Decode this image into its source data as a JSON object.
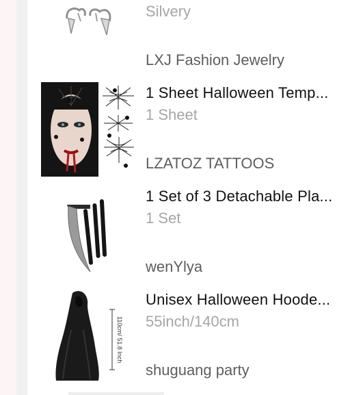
{
  "items": [
    {
      "title": "",
      "variant": "Silvery",
      "store": "LXJ Fashion Jewelry",
      "image": "vampire-fangs-image"
    },
    {
      "title": "1 Sheet Halloween Temp...",
      "variant": "1 Sheet",
      "store": "LZATOZ TATTOOS",
      "image": "spider-web-tattoo-image"
    },
    {
      "title": "1 Set of 3 Detachable Pla...",
      "variant": "1 Set",
      "store": "wenYlya",
      "image": "scythe-image"
    },
    {
      "title": "Unisex Halloween Hoode...",
      "variant": "55inch/140cm",
      "store": "shuguang party",
      "image": "hooded-cloak-image",
      "image_caption": "110cm/ 51.8 Inch"
    }
  ]
}
